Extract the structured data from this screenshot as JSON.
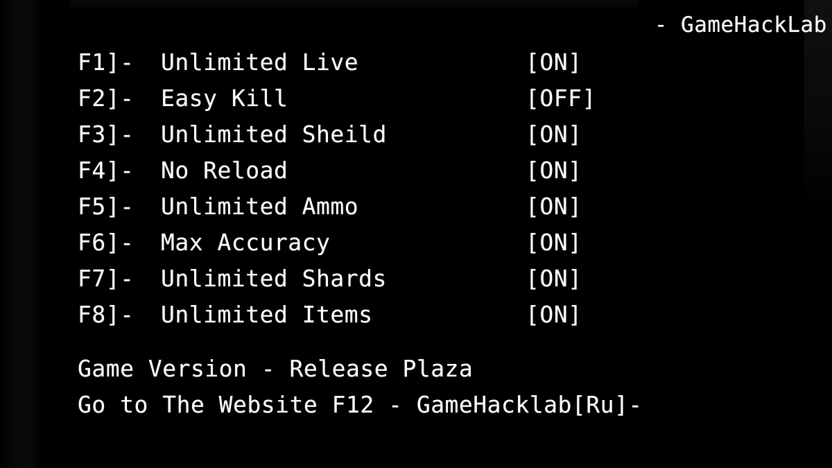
{
  "overlay": {
    "header": "- GameHackLab.",
    "background_color": "#000000",
    "text_color": "#FFFFFF"
  },
  "cheats": [
    {
      "key": "F1]-",
      "label": "Unlimited Live",
      "status": "[ON]"
    },
    {
      "key": "F2]-",
      "label": "Easy Kill",
      "status": "[OFF]"
    },
    {
      "key": "F3]-",
      "label": "Unlimited Sheild",
      "status": "[ON]"
    },
    {
      "key": "F4]-",
      "label": "No Reload",
      "status": "[ON]"
    },
    {
      "key": "F5]-",
      "label": "Unlimited Ammo",
      "status": "[ON]"
    },
    {
      "key": "F6]-",
      "label": "Max Accuracy",
      "status": "[ON]"
    },
    {
      "key": "F7]-",
      "label": "Unlimited Shards",
      "status": "[ON]"
    },
    {
      "key": "F8]-",
      "label": "Unlimited Items",
      "status": "[ON]"
    }
  ],
  "footer": {
    "game_version": "Game Version - Release Plaza",
    "website": "Go to The Website F12 - GameHacklab[Ru]-"
  }
}
